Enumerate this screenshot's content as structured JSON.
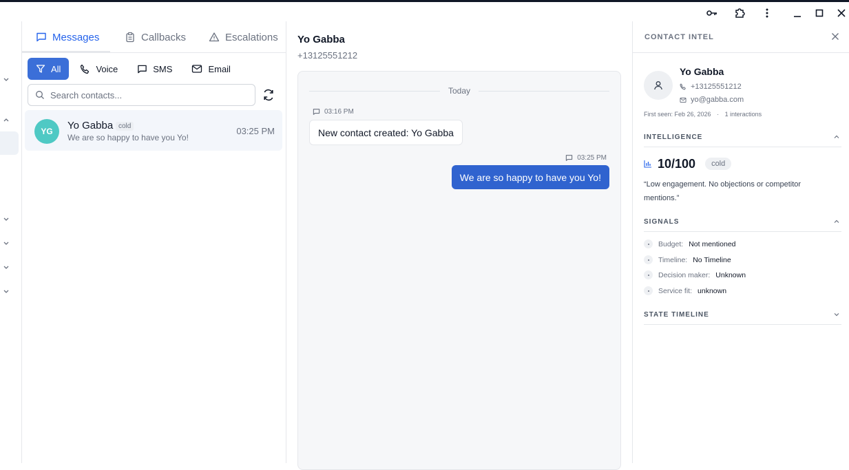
{
  "tabs": [
    {
      "label": "Messages",
      "icon": "message-square-icon",
      "active": true
    },
    {
      "label": "Callbacks",
      "icon": "clipboard-icon",
      "active": false
    },
    {
      "label": "Escalations",
      "icon": "alert-triangle-icon",
      "active": false
    }
  ],
  "filters": [
    {
      "label": "All",
      "icon": "filter-icon",
      "active": true
    },
    {
      "label": "Voice",
      "icon": "phone-icon",
      "active": false
    },
    {
      "label": "SMS",
      "icon": "message-square-icon",
      "active": false
    },
    {
      "label": "Email",
      "icon": "mail-icon",
      "active": false
    }
  ],
  "search": {
    "placeholder": "Search contacts..."
  },
  "contacts": [
    {
      "initials": "YG",
      "name": "Yo Gabba",
      "tag": "cold",
      "preview": "We are so happy to have you Yo!",
      "time": "03:25 PM"
    }
  ],
  "chat": {
    "name": "Yo Gabba",
    "phone": "+13125551212",
    "day_label": "Today",
    "messages": [
      {
        "direction": "inbound",
        "time": "03:16 PM",
        "text": "New contact created: Yo Gabba"
      },
      {
        "direction": "outbound",
        "time": "03:25 PM",
        "text": "We are so happy to have you Yo!"
      }
    ]
  },
  "intel": {
    "title": "CONTACT INTEL",
    "name": "Yo Gabba",
    "phone": "+13125551212",
    "email": "yo@gabba.com",
    "first_seen": "First seen: Feb 26, 2026",
    "interactions": "1 interactions",
    "intelligence_label": "INTELLIGENCE",
    "score": "10/100",
    "score_tag": "cold",
    "summary": "“Low engagement. No objections or competitor mentions.”",
    "signals_label": "SIGNALS",
    "signals": [
      {
        "key": "Budget:",
        "value": "Not mentioned"
      },
      {
        "key": "Timeline:",
        "value": "No Timeline"
      },
      {
        "key": "Decision maker:",
        "value": "Unknown"
      },
      {
        "key": "Service fit:",
        "value": "unknown"
      }
    ],
    "state_timeline_label": "STATE TIMELINE"
  },
  "colors": {
    "accent": "#2563eb",
    "avatar": "#4fc9c4",
    "outbound_bubble": "#3063cf"
  }
}
